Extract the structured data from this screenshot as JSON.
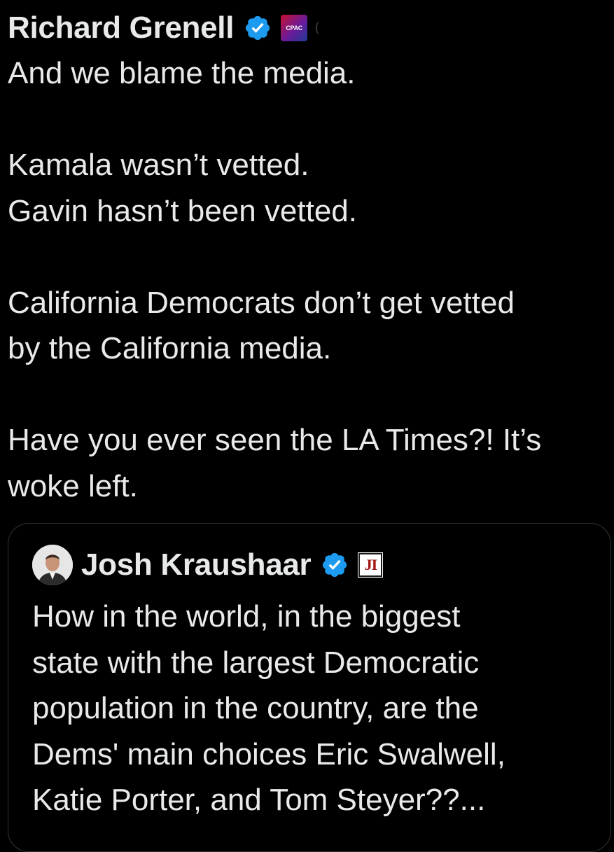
{
  "tweet": {
    "author_name": "Richard Grenell",
    "affiliate_badge_text": "CPAC",
    "body_lines": [
      "And we blame the media.",
      "",
      "Kamala wasn’t vetted.",
      "Gavin hasn’t been vetted.",
      "",
      "California Democrats don’t get vetted",
      "by the California media.",
      "",
      "Have you ever seen the LA Times?! It’s",
      "woke left."
    ]
  },
  "quote": {
    "author_name": "Josh Kraushaar",
    "affiliate_badge_text": "JI",
    "body_lines": [
      "How in the world, in the biggest",
      "state with the largest Democratic",
      "population in the country, are the",
      "Dems' main choices Eric Swalwell,",
      "Katie Porter, and Tom Steyer??..."
    ]
  },
  "colors": {
    "background": "#000000",
    "text": "#e7e9ea",
    "verified_blue": "#1d9bf0",
    "card_border": "#2f3336"
  },
  "icons": {
    "verified": "verified-checkmark-icon",
    "cpac": "cpac-affiliate-badge-icon",
    "ji": "ji-affiliate-badge-icon"
  }
}
